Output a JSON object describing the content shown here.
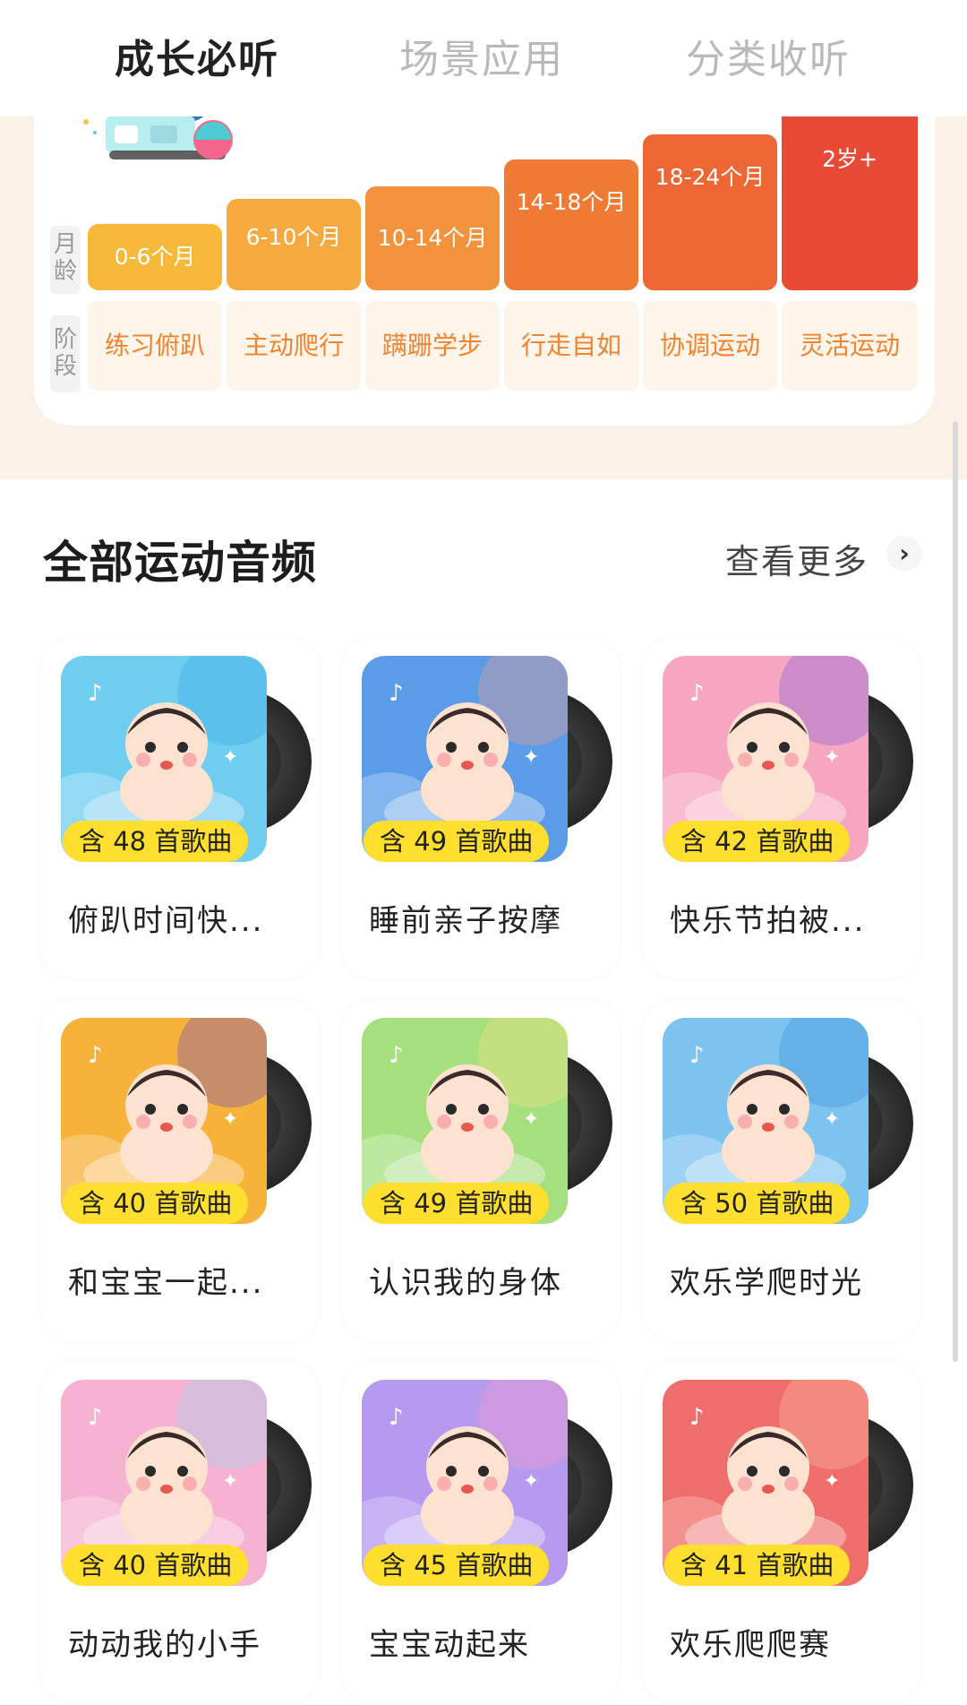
{
  "tabs": [
    {
      "label": "成长必听",
      "active": true
    },
    {
      "label": "场景应用",
      "active": false
    },
    {
      "label": "分类收听",
      "active": false
    }
  ],
  "growth": {
    "row_labels": {
      "age": "月龄",
      "stage": "阶段"
    },
    "ages": [
      "0-6个月",
      "6-10个月",
      "10-14个月",
      "14-18个月",
      "18-24个月",
      "2岁+"
    ],
    "stages": [
      "练习俯趴",
      "主动爬行",
      "蹒跚学步",
      "行走自如",
      "协调运动",
      "灵活运动"
    ],
    "bar_colors": [
      "#f8b93a",
      "#f6a93e",
      "#f2923c",
      "#ef7a34",
      "#ec6733",
      "#e84a35"
    ]
  },
  "section": {
    "title": "全部运动音频",
    "more_label": "查看更多",
    "more_icon": "chevron-right-icon"
  },
  "cards": [
    {
      "badge": "含 48 首歌曲",
      "title": "俯趴时间快...",
      "cover_bg": "#6fcdf0",
      "cover_accent": "#3aa8e8"
    },
    {
      "badge": "含 49 首歌曲",
      "title": "睡前亲子按摩",
      "cover_bg": "#5a9ce8",
      "cover_accent": "#f59a8a"
    },
    {
      "badge": "含 42 首歌曲",
      "title": "快乐节拍被...",
      "cover_bg": "#f7a6c2",
      "cover_accent": "#7a5bd6"
    },
    {
      "badge": "含 40 首歌曲",
      "title": "和宝宝一起...",
      "cover_bg": "#f7b23a",
      "cover_accent": "#6b49c9"
    },
    {
      "badge": "含 49 首歌曲",
      "title": "认识我的身体",
      "cover_bg": "#a6df7e",
      "cover_accent": "#f6e27a"
    },
    {
      "badge": "含 50 首歌曲",
      "title": "欢乐学爬时光",
      "cover_bg": "#7cc3f0",
      "cover_accent": "#3a8fd6"
    },
    {
      "badge": "含 40 首歌曲",
      "title": "动动我的小手",
      "cover_bg": "#f6b3d1",
      "cover_accent": "#9ecff2"
    },
    {
      "badge": "含 45 首歌曲",
      "title": "宝宝动起来",
      "cover_bg": "#b59af0",
      "cover_accent": "#f59ac2"
    },
    {
      "badge": "含 41 首歌曲",
      "title": "欢乐爬爬赛",
      "cover_bg": "#ef6d6a",
      "cover_accent": "#f8c0a0"
    }
  ]
}
